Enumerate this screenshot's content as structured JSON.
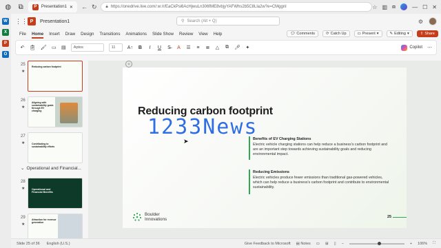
{
  "browser": {
    "tab_title": "Presentation1",
    "url": "https://onedrive.live.com/:w:/r/EaCkPsi6AcHjwuLn306fME8vbjyYAFWhs2b5C8Lla2w?e=CMggnl"
  },
  "app": {
    "doc_title": "Presentation1",
    "search_placeholder": "Search (Alt + Q)"
  },
  "menu": {
    "items": [
      "File",
      "Home",
      "Insert",
      "Draw",
      "Design",
      "Transitions",
      "Animations",
      "Slide Show",
      "Review",
      "View",
      "Help"
    ],
    "active": "Home",
    "comments": "Comments",
    "catchup": "Catch Up",
    "present": "Present",
    "editing": "Editing",
    "share": "Share"
  },
  "toolbar": {
    "font": "Aptos",
    "size": "11",
    "bold": "B",
    "italic": "I",
    "underline": "U",
    "copilot": "Copilot"
  },
  "thumbnails": [
    {
      "num": "25",
      "title": "Reducing carbon footprint",
      "selected": true,
      "dark": false
    },
    {
      "num": "26",
      "title": "Aligning with sustainability goals through EV charging",
      "selected": false,
      "dark": false
    },
    {
      "num": "27",
      "title": "Contributing to sustainability efforts",
      "selected": false,
      "dark": false
    },
    {
      "num": "28",
      "title": "Operational and Financial Benefits",
      "selected": false,
      "dark": true
    },
    {
      "num": "29",
      "title": "Attraction for revenue generation",
      "selected": false,
      "dark": false
    }
  ],
  "section_label": "Operational and Financial...",
  "slide": {
    "title": "Reducing carbon footprint",
    "sections": [
      {
        "heading": "Benefits of EV Charging Stations",
        "body": "Electric vehicle charging stations can help reduce a business's carbon footprint and are an important step towards achieving sustainability goals and reducing environmental impact."
      },
      {
        "heading": "Reducing Emissions",
        "body": "Electric vehicles produce fewer emissions than traditional gas-powered vehicles, which can help reduce a business's carbon footprint and contribute to environmental sustainability."
      }
    ],
    "logo_line1": "Boulder",
    "logo_line2": "Innovations",
    "page_number": "25",
    "watermark": "1233News"
  },
  "status": {
    "slide_info": "Slide 25 of 36",
    "language": "English (U.S.)",
    "feedback": "Give Feedback to Microsoft",
    "notes": "Notes",
    "zoom": "106%",
    "zoom_fraction": 0.55
  },
  "colors": {
    "accent": "#c43e1c",
    "green": "#2fa84f",
    "watermark": "#1a5fe0"
  }
}
